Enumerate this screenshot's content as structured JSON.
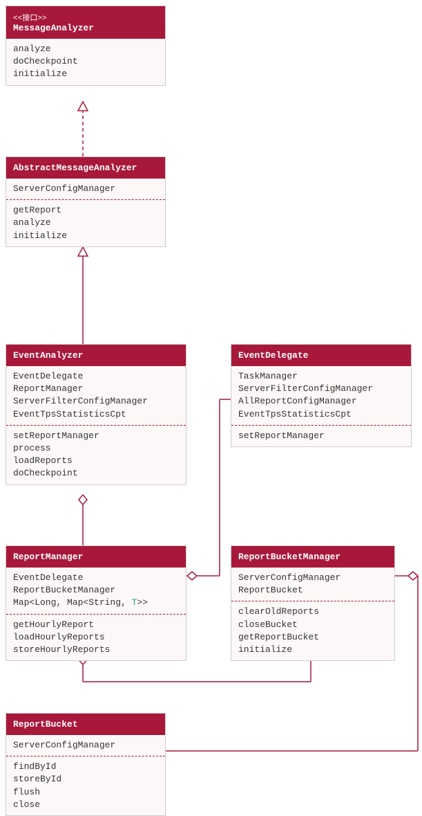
{
  "chart_data": {
    "type": "class-diagram",
    "classes": [
      {
        "id": "MessageAnalyzer",
        "stereotype": "<<接口>>",
        "name": "MessageAnalyzer",
        "attributes": [],
        "methods": [
          "analyze",
          "doCheckpoint",
          "initialize"
        ]
      },
      {
        "id": "AbstractMessageAnalyzer",
        "name": "AbstractMessageAnalyzer",
        "attributes": [
          "ServerConfigManager"
        ],
        "methods": [
          "getReport",
          "analyze",
          "initialize"
        ]
      },
      {
        "id": "EventAnalyzer",
        "name": "EventAnalyzer",
        "attributes": [
          "EventDelegate",
          "ReportManager",
          "ServerFilterConfigManager",
          "EventTpsStatisticsCpt"
        ],
        "methods": [
          "setReportManager",
          "process",
          "loadReports",
          "doCheckpoint"
        ]
      },
      {
        "id": "EventDelegate",
        "name": "EventDelegate",
        "attributes": [
          "TaskManager",
          "ServerFilterConfigManager",
          "AllReportConfigManager",
          "EventTpsStatisticsCpt"
        ],
        "methods": [
          "setReportManager"
        ]
      },
      {
        "id": "ReportManager",
        "name": "ReportManager",
        "attributes_raw": [
          {
            "text": "EventDelegate"
          },
          {
            "text": "ReportBucketManager"
          },
          {
            "prefix": "Map<Long, Map<String, ",
            "type": "T",
            "suffix": ">>"
          }
        ],
        "methods": [
          "getHourlyReport",
          "loadHourlyReports",
          "storeHourlyReports"
        ]
      },
      {
        "id": "ReportBucketManager",
        "name": "ReportBucketManager",
        "attributes": [
          "ServerConfigManager",
          "ReportBucket"
        ],
        "methods": [
          "clearOldReports",
          "closeBucket",
          "getReportBucket",
          "initialize"
        ]
      },
      {
        "id": "ReportBucket",
        "name": "ReportBucket",
        "attributes": [
          "ServerConfigManager"
        ],
        "methods": [
          "findById",
          "storeById",
          "flush",
          "close"
        ]
      }
    ],
    "relations": [
      {
        "from": "AbstractMessageAnalyzer",
        "to": "MessageAnalyzer",
        "type": "realization"
      },
      {
        "from": "EventAnalyzer",
        "to": "AbstractMessageAnalyzer",
        "type": "generalization"
      },
      {
        "from": "EventAnalyzer",
        "to": "ReportManager",
        "type": "aggregation"
      },
      {
        "from": "ReportManager",
        "to": "EventDelegate",
        "type": "aggregation"
      },
      {
        "from": "ReportManager",
        "to": "ReportBucketManager",
        "type": "aggregation"
      },
      {
        "from": "ReportBucketManager",
        "to": "ReportBucket",
        "type": "aggregation"
      }
    ]
  }
}
